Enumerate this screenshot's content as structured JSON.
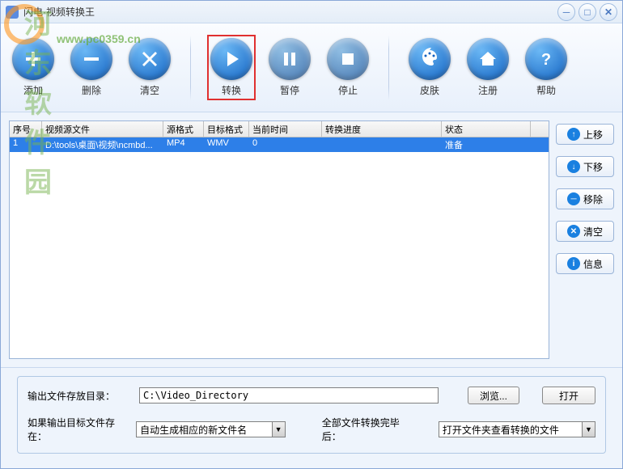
{
  "window": {
    "title": "闪电·视频转换王"
  },
  "watermark": {
    "main": "河东软件园",
    "sub": "www.pc0359.cn"
  },
  "toolbar": {
    "add": "添加",
    "delete": "删除",
    "clear": "清空",
    "convert": "转换",
    "pause": "暂停",
    "stop": "停止",
    "skin": "皮肤",
    "register": "注册",
    "help": "帮助"
  },
  "table": {
    "headers": {
      "seq": "序号",
      "source": "视频源文件",
      "src_fmt": "源格式",
      "dst_fmt": "目标格式",
      "time": "当前时间",
      "progress": "转换进度",
      "status": "状态"
    },
    "rows": [
      {
        "seq": "1",
        "source": "D:\\tools\\桌面\\视频\\ncmbd...",
        "src_fmt": "MP4",
        "dst_fmt": "WMV",
        "time": "0",
        "progress": "",
        "status": "准备"
      }
    ]
  },
  "side": {
    "up": "上移",
    "down": "下移",
    "remove": "移除",
    "clear": "清空",
    "info": "信息"
  },
  "bottom": {
    "out_dir_label": "输出文件存放目录：",
    "out_dir_value": "C:\\Video_Directory",
    "browse": "浏览...",
    "open": "打开",
    "exists_label": "如果输出目标文件存在：",
    "exists_value": "自动生成相应的新文件名",
    "after_label": "全部文件转换完毕后：",
    "after_value": "打开文件夹查看转换的文件"
  },
  "col_widths": {
    "seq": 40,
    "source": 150,
    "src_fmt": 50,
    "dst_fmt": 56,
    "time": 90,
    "progress": 148,
    "status": 110
  }
}
